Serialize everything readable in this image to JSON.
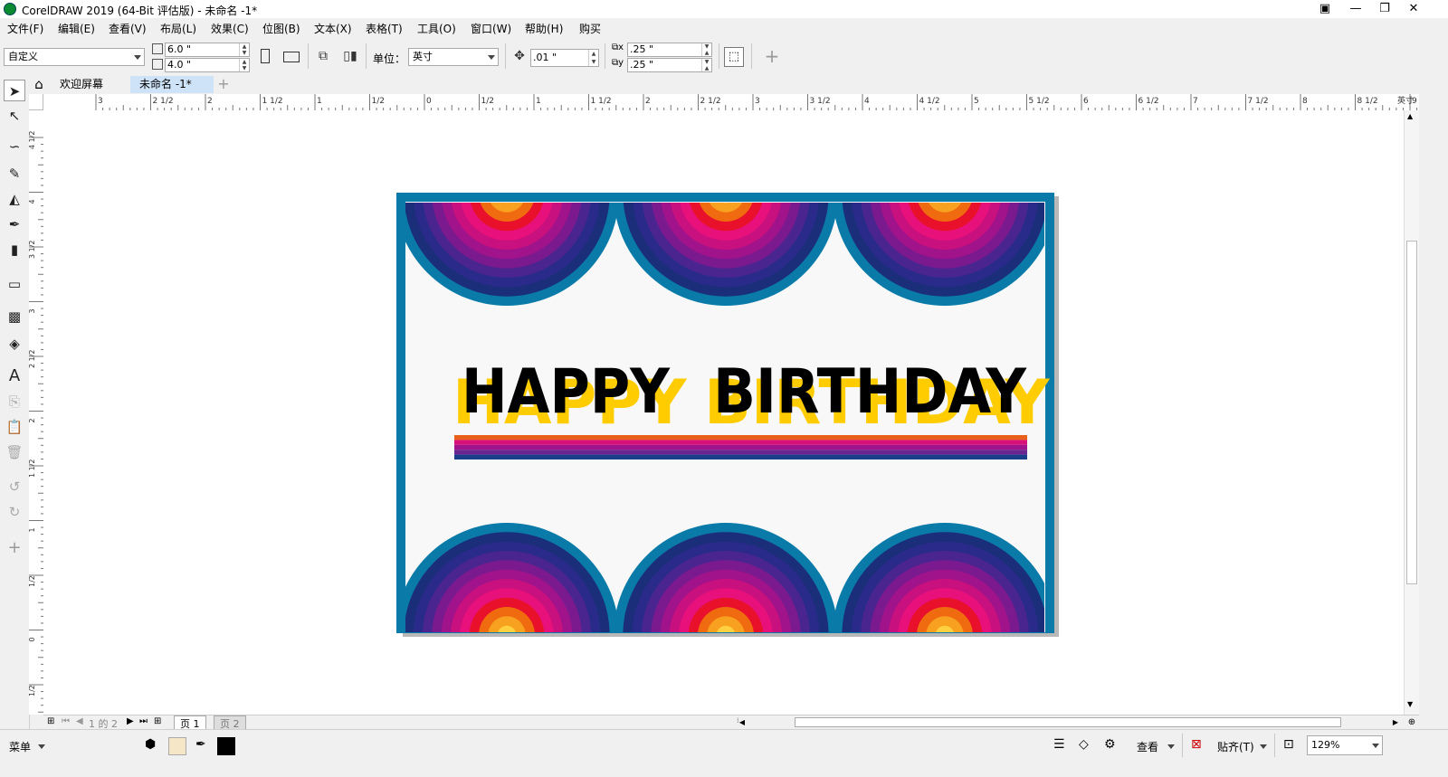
{
  "window": {
    "title": "CorelDRAW 2019 (64-Bit 评估版) - 未命名 -1*"
  },
  "menu": [
    "文件(F)",
    "编辑(E)",
    "查看(V)",
    "布局(L)",
    "效果(C)",
    "位图(B)",
    "文本(X)",
    "表格(T)",
    "工具(O)",
    "窗口(W)",
    "帮助(H)",
    "购买"
  ],
  "propbar": {
    "page_size": "自定义",
    "width": "6.0 \"",
    "height": "4.0 \"",
    "units_label": "单位：",
    "units": "英寸",
    "nudge": ".01 \"",
    "dup_x": ".25 \"",
    "dup_y": ".25 \""
  },
  "doctabs": {
    "welcome": "欢迎屏幕",
    "current": "未命名 -1*"
  },
  "ruler": {
    "h_labels": [
      "3",
      "2 1/2",
      "2",
      "1 1/2",
      "1",
      "1/2",
      "0",
      "1/2",
      "1",
      "1 1/2",
      "2",
      "2 1/2",
      "3",
      "3 1/2",
      "4",
      "4 1/2",
      "5",
      "5 1/2",
      "6",
      "6 1/2",
      "7",
      "7 1/2",
      "8",
      "8 1/2",
      "9"
    ],
    "unit": "英寸",
    "v_labels": [
      "4 1/2",
      "4",
      "3 1/2",
      "3",
      "2 1/2",
      "2",
      "1 1/2",
      "1",
      "1/2",
      "0",
      "1/2"
    ]
  },
  "card": {
    "word1": "HAPPY",
    "word2": "BIRTHDAY",
    "colors": {
      "border": "#0a7aa8",
      "background": "#f7f8f7",
      "text": "#000000",
      "shadow": "#ffcc00",
      "rings": [
        "#0a7aa8",
        "#1a2e7a",
        "#2a2a8a",
        "#4a2590",
        "#7a1a8e",
        "#a0138a",
        "#c8107e",
        "#e8107a",
        "#e8102a",
        "#f06a10",
        "#f8a020",
        "#ffd040"
      ],
      "stripes": [
        "#e8601a",
        "#d8107a",
        "#a0138a",
        "#6a2590",
        "#1a3e8a"
      ]
    }
  },
  "pagebar": {
    "page_info": "1 的 2",
    "page1": "页 1",
    "page2": "页 2"
  },
  "status": {
    "menu_label": "菜单",
    "fill_color": "#f5e6c8",
    "outline_color": "#000000",
    "view_label": "查看",
    "snap_label": "贴齐(T)",
    "zoom": "129%"
  }
}
